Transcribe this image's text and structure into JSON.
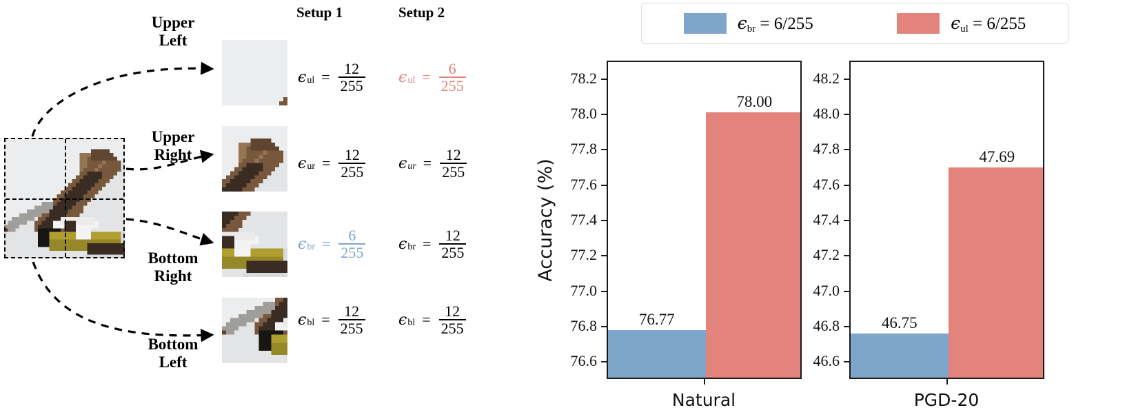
{
  "diagram": {
    "quadrant_labels": [
      {
        "id": "ul",
        "line1": "Upper",
        "line2": "Left"
      },
      {
        "id": "ur",
        "line1": "Upper",
        "line2": "Right"
      },
      {
        "id": "br",
        "line1": "Bottom",
        "line2": "Right"
      },
      {
        "id": "bl",
        "line1": "Bottom",
        "line2": "Left"
      }
    ],
    "setup_headers": {
      "setup1": "Setup 1",
      "setup2": "Setup 2"
    },
    "equations": {
      "setup1": [
        {
          "symbol": "ϵ",
          "subscript": "ul",
          "eq": "=",
          "numerator": "12",
          "denominator": "255",
          "color": "#000000"
        },
        {
          "symbol": "ϵ",
          "subscript": "ur",
          "eq": "=",
          "numerator": "12",
          "denominator": "255",
          "color": "#000000"
        },
        {
          "symbol": "ϵ",
          "subscript": "br",
          "eq": "=",
          "numerator": "6",
          "denominator": "255",
          "color": "#7ea6ca"
        },
        {
          "symbol": "ϵ",
          "subscript": "bl",
          "eq": "=",
          "numerator": "12",
          "denominator": "255",
          "color": "#000000"
        }
      ],
      "setup2": [
        {
          "symbol": "ϵ",
          "subscript": "ul",
          "eq": "=",
          "numerator": "6",
          "denominator": "255",
          "color": "#e2837c"
        },
        {
          "symbol": "ϵ",
          "subscript": "ur",
          "eq": "=",
          "numerator": "12",
          "denominator": "255",
          "color": "#000000"
        },
        {
          "symbol": "ϵ",
          "subscript": "br",
          "eq": "=",
          "numerator": "12",
          "denominator": "255",
          "color": "#000000"
        },
        {
          "symbol": "ϵ",
          "subscript": "bl",
          "eq": "=",
          "numerator": "12",
          "denominator": "255",
          "color": "#000000"
        }
      ]
    },
    "image_alt": "pixelated bird photo split into four quadrants"
  },
  "legend": {
    "entries": [
      {
        "color": "#7ea6ca",
        "symbol": "ϵ",
        "subscript": "br",
        "text": "= 6/255"
      },
      {
        "color": "#e2837c",
        "symbol": "ϵ",
        "subscript": "ul",
        "text": "= 6/255"
      }
    ]
  },
  "colors": {
    "blue": "#7ea6ca",
    "red": "#e2837c",
    "axis": "#1a1a1a"
  },
  "chart_data": [
    {
      "type": "bar",
      "title": "",
      "xlabel": "Natural",
      "ylabel": "Accuracy (%)",
      "categories": [
        "Natural"
      ],
      "ylim": [
        76.5,
        78.3
      ],
      "yticks": [
        76.6,
        76.8,
        77.0,
        77.2,
        77.4,
        77.6,
        77.8,
        78.0,
        78.2
      ],
      "ytick_labels": [
        "76.6",
        "76.8",
        "77.0",
        "77.2",
        "77.4",
        "77.6",
        "77.8",
        "78.0",
        "78.2"
      ],
      "grid": false,
      "legend_position": "above",
      "series": [
        {
          "name": "ϵ_br = 6/255",
          "color": "#7ea6ca",
          "values": [
            76.77
          ],
          "value_labels": [
            "76.77"
          ]
        },
        {
          "name": "ϵ_ul = 6/255",
          "color": "#e2837c",
          "values": [
            78.0
          ],
          "value_labels": [
            "78.00"
          ]
        }
      ]
    },
    {
      "type": "bar",
      "title": "",
      "xlabel": "PGD-20",
      "ylabel": "",
      "categories": [
        "PGD-20"
      ],
      "ylim": [
        46.5,
        48.3
      ],
      "yticks": [
        46.6,
        46.8,
        47.0,
        47.2,
        47.4,
        47.6,
        47.8,
        48.0,
        48.2
      ],
      "ytick_labels": [
        "46.6",
        "46.8",
        "47.0",
        "47.2",
        "47.4",
        "47.6",
        "47.8",
        "48.0",
        "48.2"
      ],
      "grid": false,
      "legend_position": "above",
      "series": [
        {
          "name": "ϵ_br = 6/255",
          "color": "#7ea6ca",
          "values": [
            46.75
          ],
          "value_labels": [
            "46.75"
          ]
        },
        {
          "name": "ϵ_ul = 6/255",
          "color": "#e2837c",
          "values": [
            47.69
          ],
          "value_labels": [
            "47.69"
          ]
        }
      ]
    }
  ]
}
